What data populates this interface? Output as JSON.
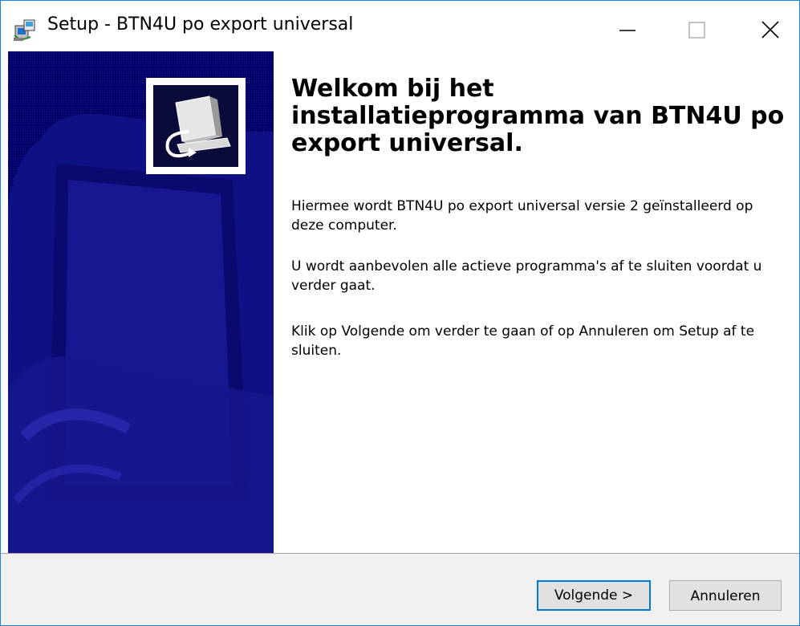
{
  "window": {
    "title": "Setup - BTN4U po export universal"
  },
  "titlebar": {
    "minimize_icon": "minimize-icon",
    "maximize_icon": "maximize-icon",
    "close_icon": "close-icon",
    "app_icon": "setup-installer-icon"
  },
  "content": {
    "heading": "Welkom bij het installatieprogramma van BTN4U po export universal.",
    "paragraph1": "Hiermee wordt BTN4U po export universal versie 2 geïnstalleerd op deze computer.",
    "paragraph2": "U wordt aanbevolen alle actieve programma's af te sluiten voordat u verder gaat.",
    "paragraph3": "Klik op Volgende om verder te gaan of op Annuleren om Setup af te sluiten."
  },
  "buttons": {
    "next_label": "Volgende >",
    "cancel_label": "Annuleren"
  },
  "colors": {
    "banner": "#000066",
    "accent": "#0078d7"
  }
}
